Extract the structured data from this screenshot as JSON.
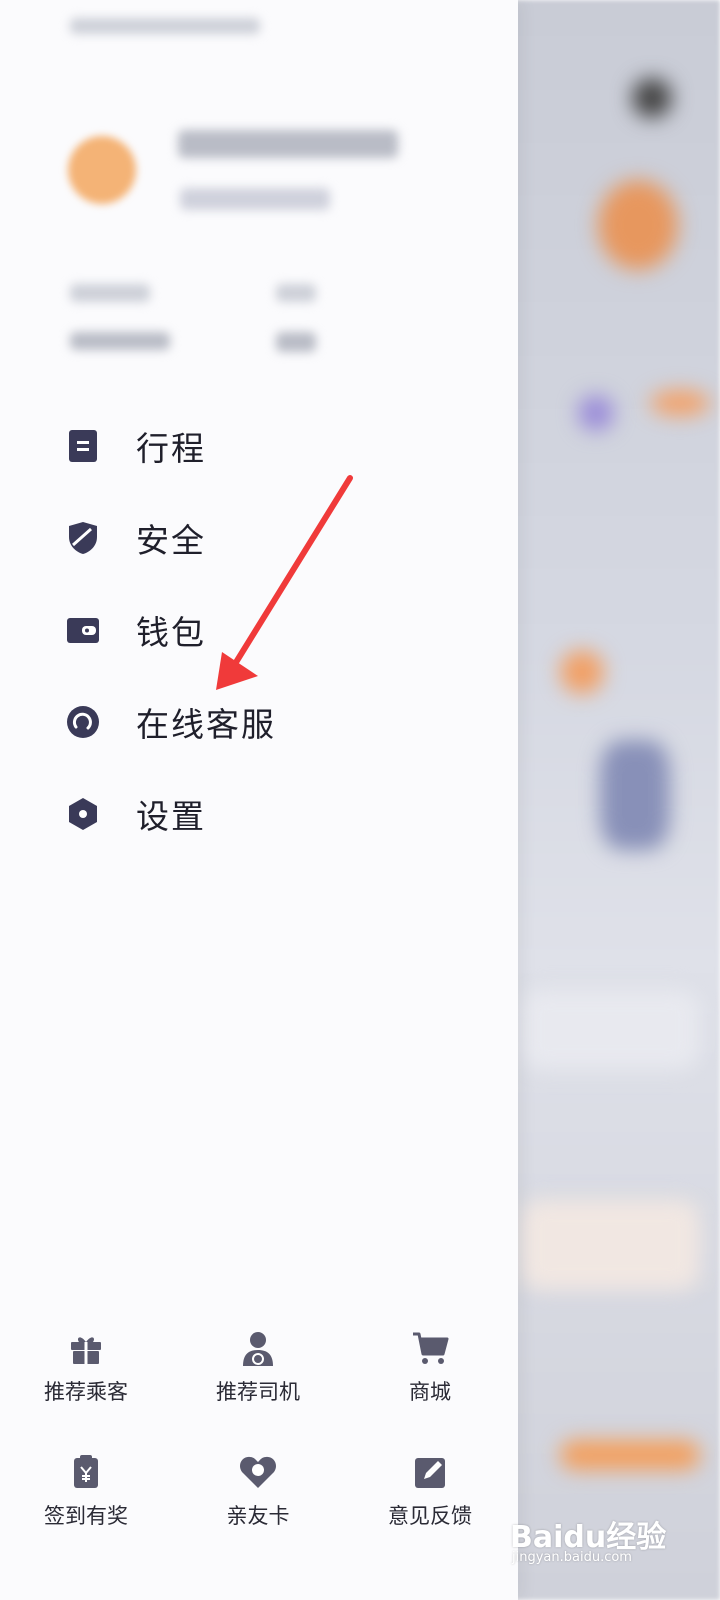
{
  "menu": {
    "items": [
      {
        "label": "行程",
        "icon": "document-icon"
      },
      {
        "label": "安全",
        "icon": "shield-icon"
      },
      {
        "label": "钱包",
        "icon": "wallet-icon"
      },
      {
        "label": "在线客服",
        "icon": "customer-service-icon"
      },
      {
        "label": "设置",
        "icon": "settings-icon"
      }
    ]
  },
  "grid": {
    "items": [
      {
        "label": "推荐乘客",
        "icon": "gift-icon"
      },
      {
        "label": "推荐司机",
        "icon": "driver-icon"
      },
      {
        "label": "商城",
        "icon": "cart-icon"
      },
      {
        "label": "签到有奖",
        "icon": "checkin-icon"
      },
      {
        "label": "亲友卡",
        "icon": "heart-card-icon"
      },
      {
        "label": "意见反馈",
        "icon": "feedback-icon"
      }
    ]
  },
  "watermark": {
    "logo": "Baidu经验",
    "url": "jingyan.baidu.com"
  },
  "colors": {
    "icon": "#3a3a58",
    "arrow": "#f03a3a",
    "avatar": "#f4b376"
  }
}
